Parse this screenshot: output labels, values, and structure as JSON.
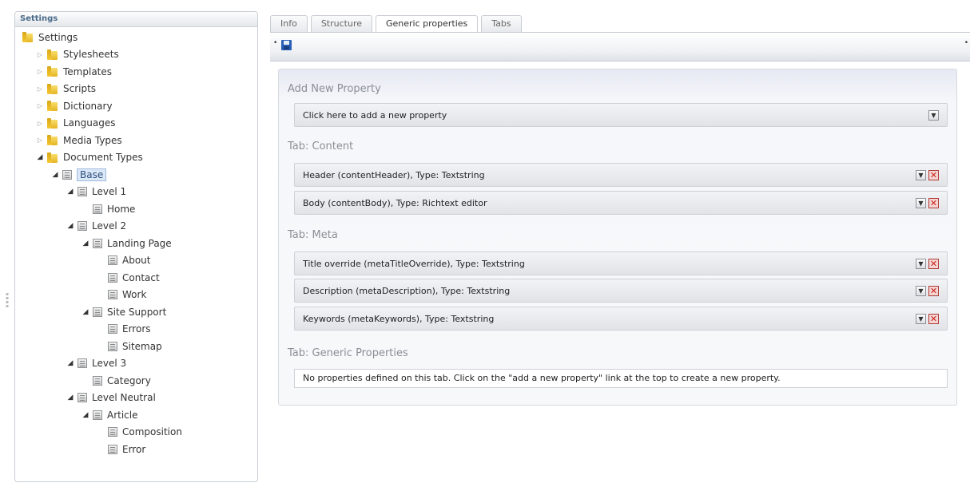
{
  "settings_panel": {
    "header": "Settings",
    "tree": [
      {
        "label": "Settings",
        "icon": "folder-icon",
        "depth": 0,
        "arrow": "none"
      },
      {
        "label": "Stylesheets",
        "icon": "folder-icon",
        "depth": 1,
        "arrow": "closed"
      },
      {
        "label": "Templates",
        "icon": "folder-icon",
        "depth": 1,
        "arrow": "closed"
      },
      {
        "label": "Scripts",
        "icon": "folder-icon",
        "depth": 1,
        "arrow": "closed"
      },
      {
        "label": "Dictionary",
        "icon": "folder-icon",
        "depth": 1,
        "arrow": "closed"
      },
      {
        "label": "Languages",
        "icon": "folder-icon",
        "depth": 1,
        "arrow": "closed"
      },
      {
        "label": "Media Types",
        "icon": "folder-icon",
        "depth": 1,
        "arrow": "closed"
      },
      {
        "label": "Document Types",
        "icon": "folder-icon",
        "depth": 1,
        "arrow": "open"
      },
      {
        "label": "Base",
        "icon": "document-type-icon",
        "depth": 2,
        "arrow": "open",
        "selected": true
      },
      {
        "label": "Level 1",
        "icon": "document-type-icon",
        "depth": 3,
        "arrow": "open"
      },
      {
        "label": "Home",
        "icon": "document-type-icon",
        "depth": 4,
        "arrow": "none"
      },
      {
        "label": "Level 2",
        "icon": "document-type-icon",
        "depth": 3,
        "arrow": "open"
      },
      {
        "label": "Landing Page",
        "icon": "document-type-icon",
        "depth": 4,
        "arrow": "open"
      },
      {
        "label": "About",
        "icon": "document-type-icon",
        "depth": 5,
        "arrow": "none"
      },
      {
        "label": "Contact",
        "icon": "document-type-icon",
        "depth": 5,
        "arrow": "none"
      },
      {
        "label": "Work",
        "icon": "document-type-icon",
        "depth": 5,
        "arrow": "none"
      },
      {
        "label": "Site Support",
        "icon": "document-type-icon",
        "depth": 4,
        "arrow": "open"
      },
      {
        "label": "Errors",
        "icon": "document-type-icon",
        "depth": 5,
        "arrow": "none"
      },
      {
        "label": "Sitemap",
        "icon": "document-type-icon",
        "depth": 5,
        "arrow": "none"
      },
      {
        "label": "Level 3",
        "icon": "document-type-icon",
        "depth": 3,
        "arrow": "open"
      },
      {
        "label": "Category",
        "icon": "document-type-icon",
        "depth": 4,
        "arrow": "none"
      },
      {
        "label": "Level Neutral",
        "icon": "document-type-icon",
        "depth": 3,
        "arrow": "open"
      },
      {
        "label": "Article",
        "icon": "document-type-icon",
        "depth": 4,
        "arrow": "open"
      },
      {
        "label": "Composition",
        "icon": "document-type-icon",
        "depth": 5,
        "arrow": "none"
      },
      {
        "label": "Error",
        "icon": "document-type-icon",
        "depth": 5,
        "arrow": "none"
      }
    ]
  },
  "tabs": [
    {
      "label": "Info",
      "active": false
    },
    {
      "label": "Structure",
      "active": false
    },
    {
      "label": "Generic properties",
      "active": true
    },
    {
      "label": "Tabs",
      "active": false
    }
  ],
  "toolbar": {
    "save_icon": "save-icon"
  },
  "properties": {
    "add_section_title": "Add New Property",
    "add_property_label": "Click here to add a new property",
    "groups": [
      {
        "title": "Tab: Content",
        "items": [
          "Header (contentHeader), Type: Textstring",
          "Body (contentBody), Type: Richtext editor"
        ]
      },
      {
        "title": "Tab: Meta",
        "items": [
          "Title override (metaTitleOverride), Type: Textstring",
          "Description (metaDescription), Type: Textstring",
          "Keywords (metaKeywords), Type: Textstring"
        ]
      }
    ],
    "generic_title": "Tab: Generic Properties",
    "generic_note": "No properties defined on this tab. Click on the \"add a new property\" link at the top to create a new property."
  },
  "colors": {
    "panel_header_text": "#4a6a8a",
    "section_title": "#8a8f96",
    "delete_red": "#cc1f17",
    "selection_bg": "#dbe8f8"
  }
}
